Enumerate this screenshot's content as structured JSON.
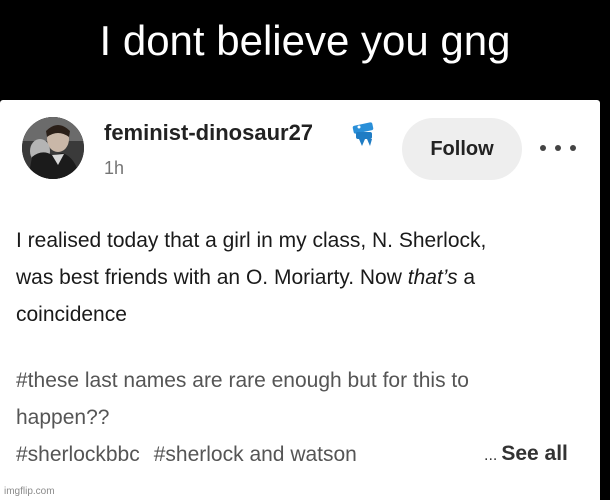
{
  "meme": {
    "caption": "I dont believe you gng",
    "watermark": "imgflip.com"
  },
  "post": {
    "username": "feminist-dinosaur27",
    "timestamp": "1h",
    "follow_label": "Follow",
    "more_icon": "more-horizontal-icon",
    "badge_icon": "blue-badge-icon",
    "body_lines": [
      "I realised today that a girl in my class, N. Sherlock,",
      "was best friends with an O. Moriarty. Now ",
      "that’s",
      " a",
      "coincidence"
    ],
    "tags": [
      "#these last names are rare enough but for this to",
      "happen??",
      "#sherlockbbc",
      "#sherlock and watson"
    ],
    "see_all_ellipsis": "...",
    "see_all_label": "See all"
  },
  "colors": {
    "background": "#000000",
    "card": "#ffffff",
    "follow_button": "#eeeeee",
    "tag_text": "#555555",
    "badge": "#1e90d6"
  }
}
